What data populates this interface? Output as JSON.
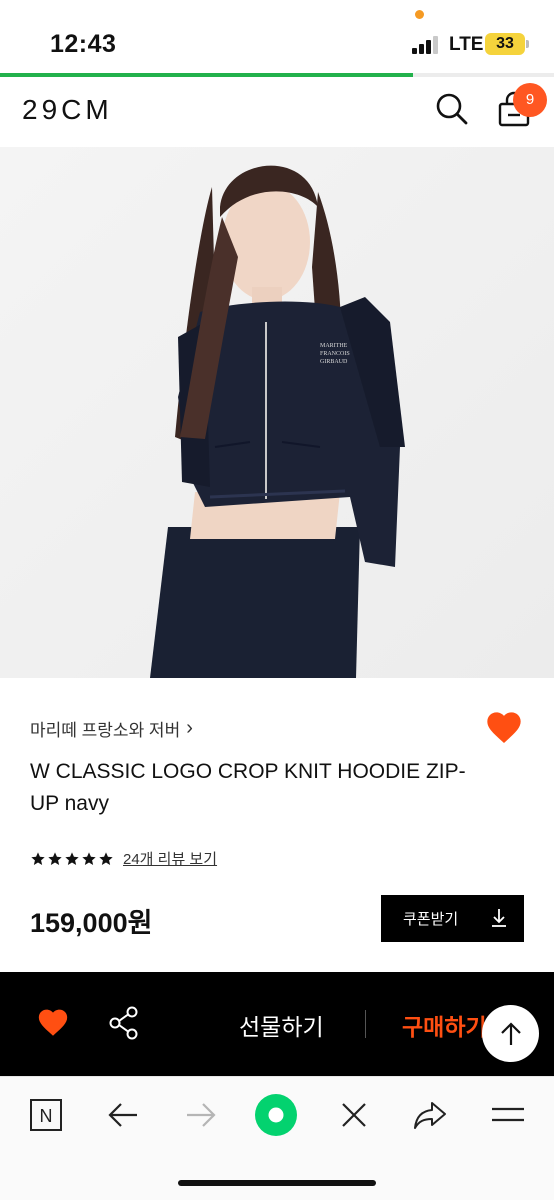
{
  "status_bar": {
    "time": "12:43",
    "network": "LTE",
    "battery": "33",
    "battery_color": "#f5d33c",
    "recording_dot_color": "#f59a23"
  },
  "page_progress": {
    "value": 0.745,
    "color": "#22b14c"
  },
  "header": {
    "logo": "29CM",
    "search_icon": "search-icon",
    "cart_icon": "shopping-bag-icon",
    "cart_count": "9",
    "badge_color": "#ff5722"
  },
  "product": {
    "image_description_icon": "product-photo",
    "brand": "마리떼 프랑소와 저버",
    "brand_chevron": "›",
    "title": "W CLASSIC LOGO CROP KNIT HOODIE ZIP-UP navy",
    "rating_stars": 5,
    "review_link": "24개 리뷰 보기",
    "price": "159,000원",
    "coupon_label": "쿠폰받기",
    "heart_color": "#ff4f12"
  },
  "action_bar": {
    "gift_label": "선물하기",
    "buy_label": "구매하기",
    "buy_color": "#ff4f12",
    "heart_icon": "heart-icon",
    "share_icon": "share-icon",
    "scroll_top_icon": "arrow-up-icon"
  },
  "browser_toolbar": {
    "items": [
      "naver-n-icon",
      "back-arrow-icon",
      "forward-arrow-icon",
      "green-home-icon",
      "close-icon",
      "share-arrow-icon",
      "menu-icon"
    ],
    "accent": "#03d26f"
  }
}
